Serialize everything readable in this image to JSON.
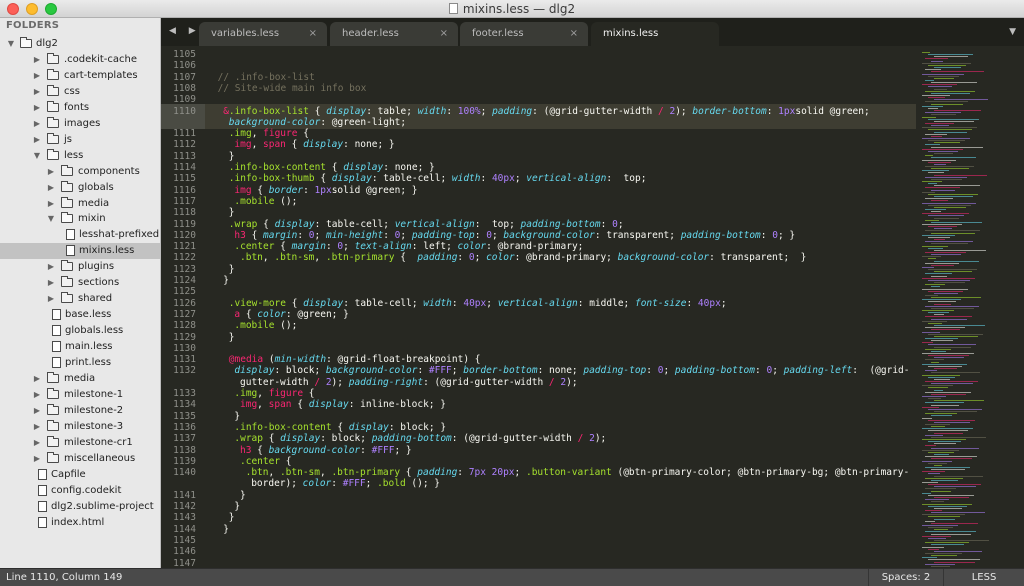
{
  "window": {
    "title": "mixins.less — dlg2"
  },
  "sidebar": {
    "header": "FOLDERS",
    "items": [
      {
        "label": "dlg2",
        "type": "folder",
        "depth": 0,
        "open": true
      },
      {
        "label": ".codekit-cache",
        "type": "folder",
        "depth": 1,
        "open": false
      },
      {
        "label": "cart-templates",
        "type": "folder",
        "depth": 1,
        "open": false
      },
      {
        "label": "css",
        "type": "folder",
        "depth": 1,
        "open": false
      },
      {
        "label": "fonts",
        "type": "folder",
        "depth": 1,
        "open": false
      },
      {
        "label": "images",
        "type": "folder",
        "depth": 1,
        "open": false
      },
      {
        "label": "js",
        "type": "folder",
        "depth": 1,
        "open": false
      },
      {
        "label": "less",
        "type": "folder",
        "depth": 1,
        "open": true
      },
      {
        "label": "components",
        "type": "folder",
        "depth": 2,
        "open": false
      },
      {
        "label": "globals",
        "type": "folder",
        "depth": 2,
        "open": false
      },
      {
        "label": "media",
        "type": "folder",
        "depth": 2,
        "open": false
      },
      {
        "label": "mixin",
        "type": "folder",
        "depth": 2,
        "open": true
      },
      {
        "label": "lesshat-prefixed.less",
        "type": "file",
        "depth": 3
      },
      {
        "label": "mixins.less",
        "type": "file",
        "depth": 3,
        "selected": true
      },
      {
        "label": "plugins",
        "type": "folder",
        "depth": 2,
        "open": false
      },
      {
        "label": "sections",
        "type": "folder",
        "depth": 2,
        "open": false
      },
      {
        "label": "shared",
        "type": "folder",
        "depth": 2,
        "open": false
      },
      {
        "label": "base.less",
        "type": "file",
        "depth": 2
      },
      {
        "label": "globals.less",
        "type": "file",
        "depth": 2
      },
      {
        "label": "main.less",
        "type": "file",
        "depth": 2
      },
      {
        "label": "print.less",
        "type": "file",
        "depth": 2
      },
      {
        "label": "media",
        "type": "folder",
        "depth": 1,
        "open": false
      },
      {
        "label": "milestone-1",
        "type": "folder",
        "depth": 1,
        "open": false
      },
      {
        "label": "milestone-2",
        "type": "folder",
        "depth": 1,
        "open": false
      },
      {
        "label": "milestone-3",
        "type": "folder",
        "depth": 1,
        "open": false
      },
      {
        "label": "milestone-cr1",
        "type": "folder",
        "depth": 1,
        "open": false
      },
      {
        "label": "miscellaneous",
        "type": "folder",
        "depth": 1,
        "open": false
      },
      {
        "label": "Capfile",
        "type": "file",
        "depth": 1
      },
      {
        "label": "config.codekit",
        "type": "file",
        "depth": 1
      },
      {
        "label": "dlg2.sublime-project",
        "type": "file",
        "depth": 1
      },
      {
        "label": "index.html",
        "type": "file",
        "depth": 1
      }
    ]
  },
  "tabs": [
    {
      "label": "variables.less",
      "active": false
    },
    {
      "label": "header.less",
      "active": false
    },
    {
      "label": "footer.less",
      "active": false
    },
    {
      "label": "mixins.less",
      "active": true
    }
  ],
  "icons": {
    "tab_close": "×",
    "nav_arrows": "◀ ▶",
    "tab_menu": "▼"
  },
  "editor": {
    "line_numbers": [
      "1105",
      "1106",
      "1107",
      "1108",
      "1109",
      "1110",
      "",
      "1111",
      "1112",
      "1113",
      "1114",
      "1115",
      "1116",
      "1117",
      "1118",
      "1119",
      "1120",
      "1121",
      "1122",
      "1123",
      "1124",
      "1125",
      "1126",
      "1127",
      "1128",
      "1129",
      "1130",
      "1131",
      "1132",
      "",
      "1133",
      "1134",
      "1135",
      "1136",
      "1137",
      "1138",
      "1139",
      "1140",
      "",
      "1141",
      "1142",
      "1143",
      "1144",
      "1145",
      "1146",
      "1147"
    ],
    "lines": [
      [],
      [],
      [
        [
          "c-cm",
          "// .info-box-list"
        ]
      ],
      [
        [
          "c-cm",
          "// Site-wide main info box"
        ]
      ],
      [],
      [
        [
          "c-amp",
          "&"
        ],
        [
          "c-sel",
          ".info-box-list"
        ],
        [
          "",
          "{ "
        ],
        [
          "c-prop",
          "display"
        ],
        [
          "",
          ": table; "
        ],
        [
          "c-prop",
          "width"
        ],
        [
          "",
          ": "
        ],
        [
          "c-num",
          "100%"
        ],
        [
          "",
          "; "
        ],
        [
          "c-prop",
          "padding"
        ],
        [
          "",
          ": (@grid-gutter-width "
        ],
        [
          "c-op",
          "/"
        ],
        [
          "c-num",
          " 2"
        ],
        [
          "",
          "); "
        ],
        [
          "c-prop",
          "border-bottom"
        ],
        [
          "",
          ": "
        ],
        [
          "c-num",
          "1px"
        ],
        [
          "",
          "solid @green;"
        ]
      ],
      [
        [
          "c-prop",
          "background-color"
        ],
        [
          "",
          ": @green-light;"
        ]
      ],
      [
        [
          "c-sel",
          ".img"
        ],
        [
          "",
          ", "
        ],
        [
          "c-tag",
          "figure"
        ],
        [
          "",
          "{"
        ]
      ],
      [
        [
          "c-tag",
          "img"
        ],
        [
          "",
          ", "
        ],
        [
          "c-tag",
          "span"
        ],
        [
          "",
          "{ "
        ],
        [
          "c-prop",
          "display"
        ],
        [
          "",
          ": none; }"
        ]
      ],
      [
        [
          "",
          "}"
        ]
      ],
      [
        [
          "c-sel",
          ".info-box-content"
        ],
        [
          "",
          "{ "
        ],
        [
          "c-prop",
          "display"
        ],
        [
          "",
          ": none; }"
        ]
      ],
      [
        [
          "c-sel",
          ".info-box-thumb"
        ],
        [
          "",
          "{ "
        ],
        [
          "c-prop",
          "display"
        ],
        [
          "",
          ": table-cell; "
        ],
        [
          "c-prop",
          "width"
        ],
        [
          "",
          ": "
        ],
        [
          "c-num",
          "40px"
        ],
        [
          "",
          "; "
        ],
        [
          "c-prop",
          "vertical-align"
        ],
        [
          "",
          ":  top;"
        ]
      ],
      [
        [
          "c-tag",
          "img"
        ],
        [
          "",
          "{ "
        ],
        [
          "c-prop",
          "border"
        ],
        [
          "",
          ": "
        ],
        [
          "c-num",
          "1px"
        ],
        [
          "",
          "solid @green; }"
        ]
      ],
      [
        [
          "c-sel",
          ".mobile"
        ],
        [
          "",
          "();"
        ]
      ],
      [
        [
          "",
          "}"
        ]
      ],
      [
        [
          "c-sel",
          ".wrap"
        ],
        [
          "",
          "{ "
        ],
        [
          "c-prop",
          "display"
        ],
        [
          "",
          ": table-cell; "
        ],
        [
          "c-prop",
          "vertical-align"
        ],
        [
          "",
          ":  top; "
        ],
        [
          "c-prop",
          "padding-bottom"
        ],
        [
          "",
          ": "
        ],
        [
          "c-num",
          "0"
        ],
        [
          "",
          ";"
        ]
      ],
      [
        [
          "c-tag",
          "h3"
        ],
        [
          "",
          "{ "
        ],
        [
          "c-prop",
          "margin"
        ],
        [
          "",
          ": "
        ],
        [
          "c-num",
          "0"
        ],
        [
          "",
          "; "
        ],
        [
          "c-prop",
          "min-height"
        ],
        [
          "",
          ": "
        ],
        [
          "c-num",
          "0"
        ],
        [
          "",
          "; "
        ],
        [
          "c-prop",
          "padding-top"
        ],
        [
          "",
          ": "
        ],
        [
          "c-num",
          "0"
        ],
        [
          "",
          "; "
        ],
        [
          "c-prop",
          "background-color"
        ],
        [
          "",
          ": transparent; "
        ],
        [
          "c-prop",
          "padding-bottom"
        ],
        [
          "",
          ": "
        ],
        [
          "c-num",
          "0"
        ],
        [
          "",
          "; }"
        ]
      ],
      [
        [
          "c-sel",
          ".center"
        ],
        [
          "",
          "{ "
        ],
        [
          "c-prop",
          "margin"
        ],
        [
          "",
          ": "
        ],
        [
          "c-num",
          "0"
        ],
        [
          "",
          "; "
        ],
        [
          "c-prop",
          "text-align"
        ],
        [
          "",
          ": left; "
        ],
        [
          "c-prop",
          "color"
        ],
        [
          "",
          ": @brand-primary;"
        ]
      ],
      [
        [
          "c-sel",
          ".btn"
        ],
        [
          "",
          ", "
        ],
        [
          "c-sel",
          ".btn-sm"
        ],
        [
          "",
          ", "
        ],
        [
          "c-sel",
          ".btn-primary"
        ],
        [
          "",
          "{  "
        ],
        [
          "c-prop",
          "padding"
        ],
        [
          "",
          ": "
        ],
        [
          "c-num",
          "0"
        ],
        [
          "",
          "; "
        ],
        [
          "c-prop",
          "color"
        ],
        [
          "",
          ": @brand-primary; "
        ],
        [
          "c-prop",
          "background-color"
        ],
        [
          "",
          ": transparent;  }"
        ]
      ],
      [
        [
          "",
          "}"
        ]
      ],
      [
        [
          "",
          "}"
        ]
      ],
      [],
      [
        [
          "c-sel",
          ".view-more"
        ],
        [
          "",
          "{ "
        ],
        [
          "c-prop",
          "display"
        ],
        [
          "",
          ": table-cell; "
        ],
        [
          "c-prop",
          "width"
        ],
        [
          "",
          ": "
        ],
        [
          "c-num",
          "40px"
        ],
        [
          "",
          "; "
        ],
        [
          "c-prop",
          "vertical-align"
        ],
        [
          "",
          ": middle; "
        ],
        [
          "c-prop",
          "font-size"
        ],
        [
          "",
          ": "
        ],
        [
          "c-num",
          "40px"
        ],
        [
          "",
          ";"
        ]
      ],
      [
        [
          "c-tag",
          "a"
        ],
        [
          "",
          "{ "
        ],
        [
          "c-prop",
          "color"
        ],
        [
          "",
          ": @green; }"
        ]
      ],
      [
        [
          "c-sel",
          ".mobile"
        ],
        [
          "",
          "();"
        ]
      ],
      [
        [
          "",
          "}"
        ]
      ],
      [],
      [
        [
          "c-at",
          "@media"
        ],
        [
          "",
          "("
        ],
        [
          "c-prop",
          "min-width"
        ],
        [
          "",
          ": @grid-float-breakpoint) {"
        ]
      ],
      [
        [
          "c-prop",
          "display"
        ],
        [
          "",
          ": block; "
        ],
        [
          "c-prop",
          "background-color"
        ],
        [
          "",
          ": "
        ],
        [
          "c-num",
          "#FFF"
        ],
        [
          "",
          "; "
        ],
        [
          "c-prop",
          "border-bottom"
        ],
        [
          "",
          ": none; "
        ],
        [
          "c-prop",
          "padding-top"
        ],
        [
          "",
          ": "
        ],
        [
          "c-num",
          "0"
        ],
        [
          "",
          "; "
        ],
        [
          "c-prop",
          "padding-bottom"
        ],
        [
          "",
          ": "
        ],
        [
          "c-num",
          "0"
        ],
        [
          "",
          "; "
        ],
        [
          "c-prop",
          "padding-left"
        ],
        [
          "",
          ":  (@grid-"
        ]
      ],
      [
        [
          "",
          "gutter-width "
        ],
        [
          "c-op",
          "/"
        ],
        [
          "c-num",
          " 2"
        ],
        [
          "",
          "); "
        ],
        [
          "c-prop",
          "padding-right"
        ],
        [
          "",
          ": (@grid-gutter-width "
        ],
        [
          "c-op",
          "/"
        ],
        [
          "c-num",
          " 2"
        ],
        [
          "",
          ");"
        ]
      ],
      [
        [
          "c-sel",
          ".img"
        ],
        [
          "",
          ", "
        ],
        [
          "c-tag",
          "figure"
        ],
        [
          "",
          "{"
        ]
      ],
      [
        [
          "c-tag",
          "img"
        ],
        [
          "",
          ", "
        ],
        [
          "c-tag",
          "span"
        ],
        [
          "",
          "{ "
        ],
        [
          "c-prop",
          "display"
        ],
        [
          "",
          ": inline-block; }"
        ]
      ],
      [
        [
          "",
          "}"
        ]
      ],
      [
        [
          "c-sel",
          ".info-box-content"
        ],
        [
          "",
          "{ "
        ],
        [
          "c-prop",
          "display"
        ],
        [
          "",
          ": block; }"
        ]
      ],
      [
        [
          "c-sel",
          ".wrap"
        ],
        [
          "",
          "{ "
        ],
        [
          "c-prop",
          "display"
        ],
        [
          "",
          ": block; "
        ],
        [
          "c-prop",
          "padding-bottom"
        ],
        [
          "",
          ": (@grid-gutter-width "
        ],
        [
          "c-op",
          "/"
        ],
        [
          "c-num",
          " 2"
        ],
        [
          "",
          "); "
        ]
      ],
      [
        [
          "c-tag",
          "h3"
        ],
        [
          "",
          "{ "
        ],
        [
          "c-prop",
          "background-color"
        ],
        [
          "",
          ": "
        ],
        [
          "c-num",
          "#FFF"
        ],
        [
          "",
          "; }"
        ]
      ],
      [
        [
          "c-sel",
          ".center"
        ],
        [
          "",
          "{"
        ]
      ],
      [
        [
          "c-sel",
          ".btn"
        ],
        [
          "",
          ", "
        ],
        [
          "c-sel",
          ".btn-sm"
        ],
        [
          "",
          ", "
        ],
        [
          "c-sel",
          ".btn-primary"
        ],
        [
          "",
          "{ "
        ],
        [
          "c-prop",
          "padding"
        ],
        [
          "",
          ": "
        ],
        [
          "c-num",
          "7px 20px"
        ],
        [
          "",
          "; "
        ],
        [
          "c-sel",
          ".button-variant"
        ],
        [
          "",
          "(@btn-primary-color; @btn-primary-bg; @btn-primary-"
        ]
      ],
      [
        [
          "",
          "border); "
        ],
        [
          "c-prop",
          "color"
        ],
        [
          "",
          ": "
        ],
        [
          "c-num",
          "#FFF"
        ],
        [
          "",
          "; "
        ],
        [
          "c-sel",
          ".bold"
        ],
        [
          "",
          "(); }"
        ]
      ],
      [
        [
          "",
          "}"
        ]
      ],
      [
        [
          "",
          "}"
        ]
      ],
      [
        [
          "",
          "}"
        ]
      ],
      [
        [
          "",
          "}"
        ]
      ],
      [],
      [],
      []
    ],
    "indents": [
      0,
      0,
      1,
      1,
      0,
      2,
      3,
      3,
      4,
      3,
      3,
      3,
      4,
      4,
      3,
      3,
      4,
      4,
      5,
      3,
      2,
      0,
      3,
      4,
      4,
      3,
      0,
      3,
      4,
      5,
      4,
      5,
      4,
      4,
      4,
      5,
      5,
      6,
      7,
      5,
      4,
      3,
      2,
      0,
      0,
      0
    ]
  },
  "colors": {
    "bg": "#272822",
    "comment": "#75715e",
    "selector": "#a6e22e",
    "property": "#66d9ef",
    "keyword": "#f92672",
    "number": "#ae81ff",
    "text": "#f8f8f2",
    "sidebar_bg": "#e8e8e8"
  },
  "status": {
    "position": "Line 1110, Column 149",
    "spaces": "Spaces: 2",
    "syntax": "LESS"
  }
}
